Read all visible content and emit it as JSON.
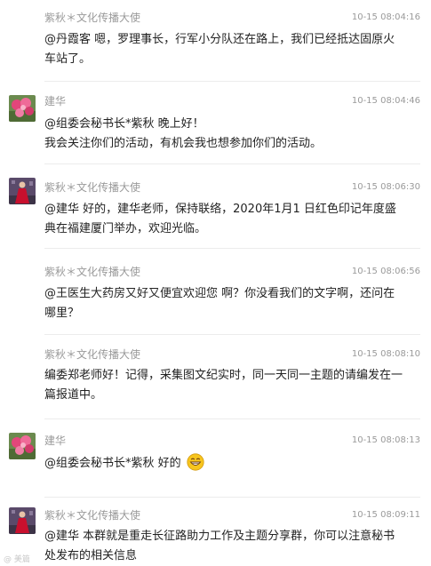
{
  "comments": [
    {
      "author": "紫秋＊文化传播大使",
      "time": "10-15 08:04:16",
      "text": "@丹霞客 嗯，罗理事长，行军小分队还在路上，我们已经抵达固原火车站了。",
      "avatar": "none"
    },
    {
      "author": "建华",
      "time": "10-15 08:04:46",
      "text": "@组委会秘书长*紫秋 晚上好！\n我会关注你们的活动，有机会我也想参加你们的活动。",
      "avatar": "pink-flower-avatar"
    },
    {
      "author": "紫秋＊文化传播大使",
      "time": "10-15 08:06:30",
      "text": "@建华 好的，建华老师，保持联络，2020年1月1 日红色印记年度盛典在福建厦门举办，欢迎光临。",
      "avatar": "red-dress-avatar"
    },
    {
      "author": "紫秋＊文化传播大使",
      "time": "10-15 08:06:56",
      "text": "@王医生大药房又好又便宜欢迎您 啊？你没看我们的文字啊，还问在哪里？",
      "avatar": "none"
    },
    {
      "author": "紫秋＊文化传播大使",
      "time": "10-15 08:08:10",
      "text": "编委郑老师好！记得，采集图文纪实时，同一天同一主题的请编发在一篇报道中。",
      "avatar": "none"
    },
    {
      "author": "建华",
      "time": "10-15 08:08:13",
      "text": "@组委会秘书长*紫秋 好的",
      "emoji": "grin-emoji",
      "avatar": "pink-flower-avatar"
    },
    {
      "author": "紫秋＊文化传播大使",
      "time": "10-15 08:09:11",
      "text": "@建华 本群就是重走长征路助力工作及主题分享群，你可以注意秘书处发布的相关信息",
      "avatar": "red-dress-avatar"
    }
  ],
  "watermark": "@ 美篇",
  "colors": {
    "meta_text": "#9a9a9a",
    "body_text": "#222222",
    "divider": "#ececec"
  }
}
